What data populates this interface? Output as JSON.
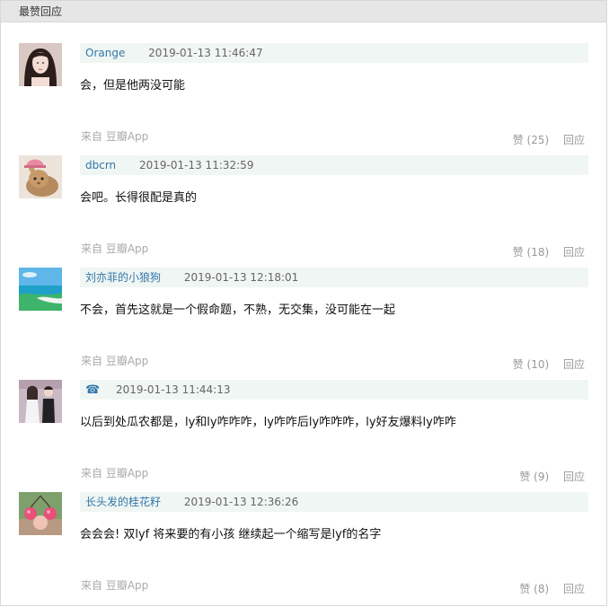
{
  "section_title": "最赞回应",
  "comments": [
    {
      "user": "Orange",
      "time": "2019-01-13 11:46:47",
      "content": "会，但是他两没可能",
      "source": "来自 豆瓣App",
      "votes": "赞 (25)",
      "reply": "回应",
      "avatar_icon": "avatar-girl-icon"
    },
    {
      "user": "dbcrn",
      "time": "2019-01-13 11:32:59",
      "content": "会吧。长得很配是真的",
      "source": "来自 豆瓣App",
      "votes": "赞 (18)",
      "reply": "回应",
      "avatar_icon": "avatar-rabbit-icon"
    },
    {
      "user": "刘亦菲的小狼狗",
      "time": "2019-01-13 12:18:01",
      "content": "不会，首先这就是一个假命题，不熟，无交集，没可能在一起",
      "source": "来自 豆瓣App",
      "votes": "赞 (10)",
      "reply": "回应",
      "avatar_icon": "avatar-beach-icon"
    },
    {
      "user": "☎",
      "time": "2019-01-13 11:44:13",
      "content": "以后到处瓜农都是，ly和ly咋咋咋，ly咋咋后ly咋咋咋，ly好友爆料ly咋咋",
      "source": "来自 豆瓣App",
      "votes": "赞 (9)",
      "reply": "回应",
      "avatar_icon": "avatar-couple-icon"
    },
    {
      "user": "长头发的桂花籽",
      "time": "2019-01-13 12:36:26",
      "content": "会会会! 双lyf 将来要的有小孩 继续起一个缩写是lyf的名字",
      "source": "来自 豆瓣App",
      "votes": "赞 (8)",
      "reply": "回应",
      "avatar_icon": "avatar-cherry-icon"
    }
  ],
  "colors": {
    "link": "#3377aa",
    "meta_bg": "#f0f6f3",
    "header_bg": "#e6e6e6",
    "muted": "#999999"
  }
}
